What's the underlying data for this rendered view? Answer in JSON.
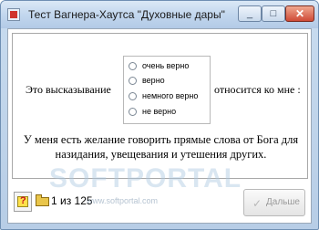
{
  "window": {
    "title": "Тест Вагнера-Хаутса \"Духовные дары\"",
    "minimize_glyph": "_",
    "maximize_glyph": "□",
    "close_glyph": "✕"
  },
  "question": {
    "prefix": "Это высказывание",
    "suffix": "относится ко мне :",
    "options": [
      "очень верно",
      "верно",
      "немного верно",
      "не верно"
    ],
    "statement_line1": "У меня есть желание говорить прямые слова от Бога для",
    "statement_line2": "назидания, увещевания и утешения других."
  },
  "footer": {
    "help_glyph": "?",
    "counter": "1 из 125",
    "next_label": "Дальше",
    "next_icon_glyph": "✓"
  },
  "watermark": {
    "text": "SOFTPORTAL",
    "url": "www.softportal.com"
  }
}
